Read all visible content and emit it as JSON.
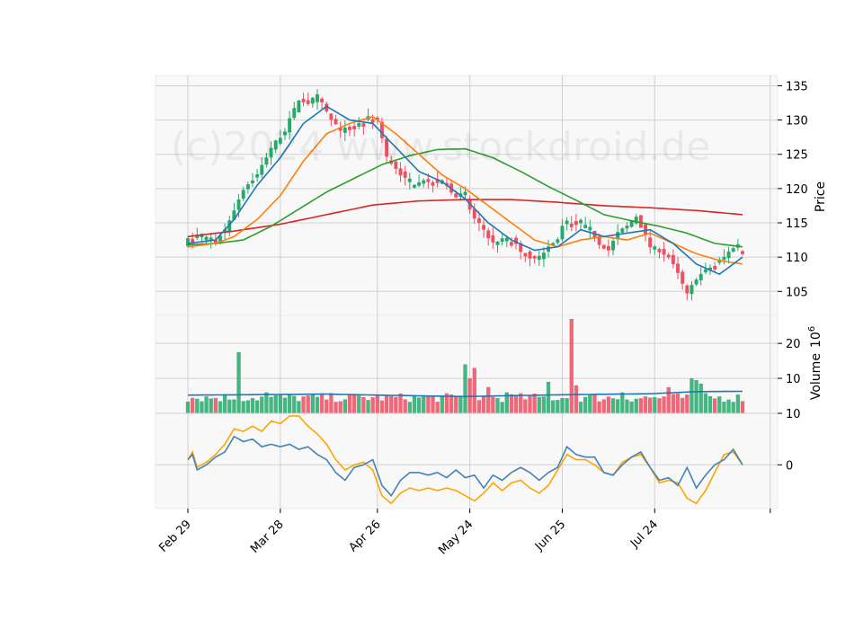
{
  "watermark": "(c)2024 www.stockdroid.de",
  "colors": {
    "up": "#26a96c",
    "down": "#ef4f60",
    "ma_blue": "#1f77b4",
    "ma_orange": "#ff7f0e",
    "ma_green": "#2ca02c",
    "ma_red": "#d62728",
    "vol_ma": "#1f77b4",
    "osc_fast": "#4682b4",
    "osc_slow": "#ffa500",
    "panel_bg": "#f8f8f8",
    "grid": "#d0d0d0"
  },
  "chart_data": [
    {
      "type": "candlestick",
      "panel": "price",
      "ylabel": "Price",
      "yticks": [
        105,
        110,
        115,
        120,
        125,
        130,
        135
      ],
      "ylim": [
        101.5,
        136.5
      ],
      "xticks": [
        "Feb 29",
        "Mar 28",
        "Apr 26",
        "May 24",
        "Jun 25",
        "Jul 24"
      ],
      "xtick_index": [
        0,
        20,
        41,
        61,
        81,
        101
      ],
      "n": 121,
      "keypoints_close": [
        [
          0,
          112.5
        ],
        [
          2,
          113
        ],
        [
          4,
          112
        ],
        [
          6,
          112.5
        ],
        [
          8,
          114
        ],
        [
          10,
          117
        ],
        [
          12,
          120
        ],
        [
          15,
          122
        ],
        [
          18,
          126
        ],
        [
          21,
          128.5
        ],
        [
          24,
          133
        ],
        [
          26,
          132.5
        ],
        [
          28,
          133.5
        ],
        [
          31,
          130
        ],
        [
          33,
          128.5
        ],
        [
          36,
          129
        ],
        [
          39,
          130
        ],
        [
          41,
          130
        ],
        [
          43,
          124.5
        ],
        [
          45,
          123
        ],
        [
          48,
          120.5
        ],
        [
          50,
          121
        ],
        [
          52,
          121
        ],
        [
          55,
          121
        ],
        [
          58,
          119
        ],
        [
          60,
          118.5
        ],
        [
          62,
          115.5
        ],
        [
          64,
          114
        ],
        [
          66,
          112
        ],
        [
          68,
          112
        ],
        [
          70,
          112.5
        ],
        [
          72,
          111
        ],
        [
          74,
          110
        ],
        [
          76,
          110
        ],
        [
          78,
          111.5
        ],
        [
          80,
          112.5
        ],
        [
          81,
          114.5
        ],
        [
          83,
          115
        ],
        [
          85,
          114.5
        ],
        [
          87,
          114
        ],
        [
          89,
          112
        ],
        [
          91,
          111
        ],
        [
          93,
          113.5
        ],
        [
          95,
          114.5
        ],
        [
          97,
          116
        ],
        [
          99,
          113
        ],
        [
          100,
          111.5
        ],
        [
          102,
          111
        ],
        [
          104,
          110
        ],
        [
          106,
          107.5
        ],
        [
          108,
          104.5
        ],
        [
          110,
          107
        ],
        [
          112,
          108
        ],
        [
          114,
          109
        ],
        [
          116,
          110
        ],
        [
          118,
          111.5
        ],
        [
          120,
          110.5
        ]
      ],
      "series": [
        {
          "name": "",
          "keypoints": [
            [
              0,
              112
            ],
            [
              6,
              112.5
            ],
            [
              10,
              115.5
            ],
            [
              15,
              120.5
            ],
            [
              20,
              124.5
            ],
            [
              25,
              129.5
            ],
            [
              30,
              132
            ],
            [
              35,
              130
            ],
            [
              40,
              129.5
            ],
            [
              45,
              126
            ],
            [
              50,
              122.5
            ],
            [
              55,
              121
            ],
            [
              60,
              118.5
            ],
            [
              65,
              115
            ],
            [
              70,
              112.5
            ],
            [
              75,
              111
            ],
            [
              80,
              111.5
            ],
            [
              85,
              114
            ],
            [
              90,
              113
            ],
            [
              95,
              113.5
            ],
            [
              100,
              114
            ],
            [
              105,
              112
            ],
            [
              110,
              109
            ],
            [
              115,
              107.5
            ],
            [
              120,
              110
            ]
          ]
        },
        {
          "name": "",
          "keypoints": [
            [
              0,
              111.5
            ],
            [
              6,
              112
            ],
            [
              10,
              113
            ],
            [
              15,
              115.5
            ],
            [
              20,
              119
            ],
            [
              25,
              124
            ],
            [
              30,
              128
            ],
            [
              35,
              129.5
            ],
            [
              40,
              130.5
            ],
            [
              45,
              128
            ],
            [
              50,
              125
            ],
            [
              55,
              122
            ],
            [
              60,
              120
            ],
            [
              65,
              117.5
            ],
            [
              70,
              115
            ],
            [
              75,
              112.5
            ],
            [
              80,
              111.5
            ],
            [
              85,
              112.5
            ],
            [
              90,
              113
            ],
            [
              95,
              112.5
            ],
            [
              100,
              113.5
            ],
            [
              105,
              112
            ],
            [
              110,
              110.5
            ],
            [
              115,
              109.5
            ],
            [
              120,
              109
            ]
          ]
        },
        {
          "name": "",
          "keypoints": [
            [
              0,
              111.8
            ],
            [
              6,
              112
            ],
            [
              12,
              112.5
            ],
            [
              18,
              114.5
            ],
            [
              24,
              117
            ],
            [
              30,
              119.5
            ],
            [
              36,
              121.5
            ],
            [
              42,
              123.5
            ],
            [
              48,
              124.8
            ],
            [
              54,
              125.7
            ],
            [
              60,
              125.8
            ],
            [
              66,
              124.5
            ],
            [
              72,
              122.5
            ],
            [
              78,
              120.3
            ],
            [
              84,
              118.3
            ],
            [
              90,
              116.2
            ],
            [
              96,
              115.3
            ],
            [
              102,
              114.5
            ],
            [
              108,
              113.5
            ],
            [
              114,
              112
            ],
            [
              120,
              111.5
            ]
          ]
        },
        {
          "name": "",
          "keypoints": [
            [
              0,
              113
            ],
            [
              10,
              113.8
            ],
            [
              20,
              114.8
            ],
            [
              30,
              116.2
            ],
            [
              40,
              117.6
            ],
            [
              50,
              118.2
            ],
            [
              60,
              118.4
            ],
            [
              70,
              118.4
            ],
            [
              80,
              118
            ],
            [
              90,
              117.5
            ],
            [
              100,
              117.2
            ],
            [
              110,
              116.8
            ],
            [
              120,
              116.2
            ]
          ]
        }
      ]
    },
    {
      "type": "bar",
      "panel": "volume",
      "ylabel": "Volume",
      "yunit": "10",
      "yunit_exp": "6",
      "yticks": [
        10,
        20
      ],
      "ylim": [
        0,
        28
      ],
      "spikes": [
        [
          11,
          17.5
        ],
        [
          17,
          6
        ],
        [
          60,
          14
        ],
        [
          61,
          10
        ],
        [
          62,
          13
        ],
        [
          65,
          7.5
        ],
        [
          69,
          6
        ],
        [
          78,
          9
        ],
        [
          83,
          27
        ],
        [
          84,
          8
        ],
        [
          94,
          6
        ],
        [
          104,
          7.5
        ],
        [
          109,
          10
        ],
        [
          110,
          9.5
        ],
        [
          111,
          8.5
        ]
      ],
      "vol_ma": [
        [
          0,
          5.2
        ],
        [
          30,
          5.5
        ],
        [
          50,
          5.0
        ],
        [
          60,
          4.8
        ],
        [
          80,
          5.3
        ],
        [
          100,
          5.6
        ],
        [
          110,
          6.2
        ],
        [
          120,
          6.3
        ]
      ]
    },
    {
      "type": "line",
      "panel": "oscillator",
      "yticks": [
        0,
        10
      ],
      "ylim": [
        -8.5,
        10
      ],
      "series": [
        {
          "name": "",
          "keypoints": [
            [
              0,
              1
            ],
            [
              1,
              2
            ],
            [
              2,
              -1
            ],
            [
              4,
              0
            ],
            [
              6,
              1.5
            ],
            [
              8,
              2.5
            ],
            [
              10,
              5.5
            ],
            [
              12,
              4.5
            ],
            [
              14,
              5
            ],
            [
              16,
              3.5
            ],
            [
              18,
              4
            ],
            [
              20,
              3.5
            ],
            [
              22,
              4
            ],
            [
              24,
              3
            ],
            [
              26,
              3.5
            ],
            [
              28,
              2
            ],
            [
              30,
              1
            ],
            [
              32,
              -1.5
            ],
            [
              34,
              -3
            ],
            [
              36,
              -0.5
            ],
            [
              38,
              0
            ],
            [
              40,
              1
            ],
            [
              42,
              -4
            ],
            [
              44,
              -6
            ],
            [
              46,
              -3
            ],
            [
              48,
              -1.5
            ],
            [
              50,
              -1.5
            ],
            [
              52,
              -2
            ],
            [
              54,
              -1.5
            ],
            [
              56,
              -2.5
            ],
            [
              58,
              -1
            ],
            [
              60,
              -2.5
            ],
            [
              62,
              -2
            ],
            [
              64,
              -4.5
            ],
            [
              66,
              -2
            ],
            [
              68,
              -3
            ],
            [
              70,
              -1.5
            ],
            [
              72,
              -0.5
            ],
            [
              74,
              -1.5
            ],
            [
              76,
              -3
            ],
            [
              78,
              -1.5
            ],
            [
              80,
              -0.5
            ],
            [
              82,
              3.5
            ],
            [
              84,
              2
            ],
            [
              86,
              1.5
            ],
            [
              88,
              1.5
            ],
            [
              90,
              -1.5
            ],
            [
              92,
              -2
            ],
            [
              94,
              0
            ],
            [
              96,
              1.5
            ],
            [
              98,
              2.5
            ],
            [
              100,
              -0.5
            ],
            [
              102,
              -3
            ],
            [
              104,
              -2.5
            ],
            [
              106,
              -4
            ],
            [
              108,
              -0.5
            ],
            [
              110,
              -4.5
            ],
            [
              112,
              -2
            ],
            [
              114,
              0
            ],
            [
              116,
              1
            ],
            [
              118,
              3
            ],
            [
              120,
              0
            ]
          ]
        },
        {
          "name": "",
          "keypoints": [
            [
              0,
              1
            ],
            [
              1,
              2.5
            ],
            [
              2,
              -0.5
            ],
            [
              4,
              0.5
            ],
            [
              6,
              2
            ],
            [
              8,
              4
            ],
            [
              10,
              7
            ],
            [
              12,
              6.5
            ],
            [
              14,
              7.5
            ],
            [
              16,
              6.5
            ],
            [
              18,
              8.5
            ],
            [
              20,
              8
            ],
            [
              22,
              9.5
            ],
            [
              24,
              9.5
            ],
            [
              26,
              7.5
            ],
            [
              28,
              6
            ],
            [
              30,
              4
            ],
            [
              32,
              1
            ],
            [
              34,
              -1
            ],
            [
              36,
              0
            ],
            [
              38,
              0.5
            ],
            [
              40,
              -1
            ],
            [
              42,
              -6
            ],
            [
              44,
              -7.5
            ],
            [
              46,
              -5.5
            ],
            [
              48,
              -4.5
            ],
            [
              50,
              -5
            ],
            [
              52,
              -4.5
            ],
            [
              54,
              -5
            ],
            [
              56,
              -4.5
            ],
            [
              58,
              -5
            ],
            [
              60,
              -6
            ],
            [
              62,
              -7
            ],
            [
              64,
              -5.5
            ],
            [
              66,
              -3.5
            ],
            [
              68,
              -5
            ],
            [
              70,
              -3.5
            ],
            [
              72,
              -3
            ],
            [
              74,
              -4.5
            ],
            [
              76,
              -5.5
            ],
            [
              78,
              -4
            ],
            [
              80,
              -1
            ],
            [
              82,
              2
            ],
            [
              84,
              1
            ],
            [
              86,
              1
            ],
            [
              88,
              0
            ],
            [
              90,
              -1.5
            ],
            [
              92,
              -2
            ],
            [
              94,
              0.5
            ],
            [
              96,
              1.5
            ],
            [
              98,
              2
            ],
            [
              100,
              -0.5
            ],
            [
              102,
              -3.5
            ],
            [
              104,
              -3
            ],
            [
              106,
              -3.5
            ],
            [
              108,
              -6.5
            ],
            [
              110,
              -7.5
            ],
            [
              112,
              -5
            ],
            [
              114,
              -1.5
            ],
            [
              116,
              2
            ],
            [
              118,
              2.5
            ],
            [
              120,
              0
            ]
          ]
        }
      ]
    }
  ]
}
